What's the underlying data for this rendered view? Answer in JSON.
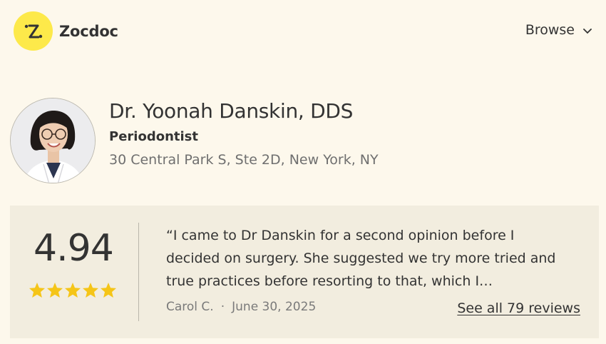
{
  "header": {
    "brand": "Zocdoc",
    "brand_color": "#fde94a",
    "browse_label": "Browse",
    "browse_icon": "chevron-down-icon"
  },
  "doctor": {
    "name": "Dr. Yoonah Danskin, DDS",
    "specialty": "Periodontist",
    "address": "30 Central Park S, Ste 2D, New York, NY"
  },
  "review_summary": {
    "rating": "4.94",
    "stars": 5,
    "star_color": "#f5c518",
    "quote": "“I came to Dr Danskin for a second opinion before I decided on surgery. She suggested we try more tried and true practices before resorting to that, which I…",
    "reviewer": "Carol C.",
    "separator": "·",
    "date": "June 30, 2025",
    "see_all_label": "See all 79 reviews"
  }
}
